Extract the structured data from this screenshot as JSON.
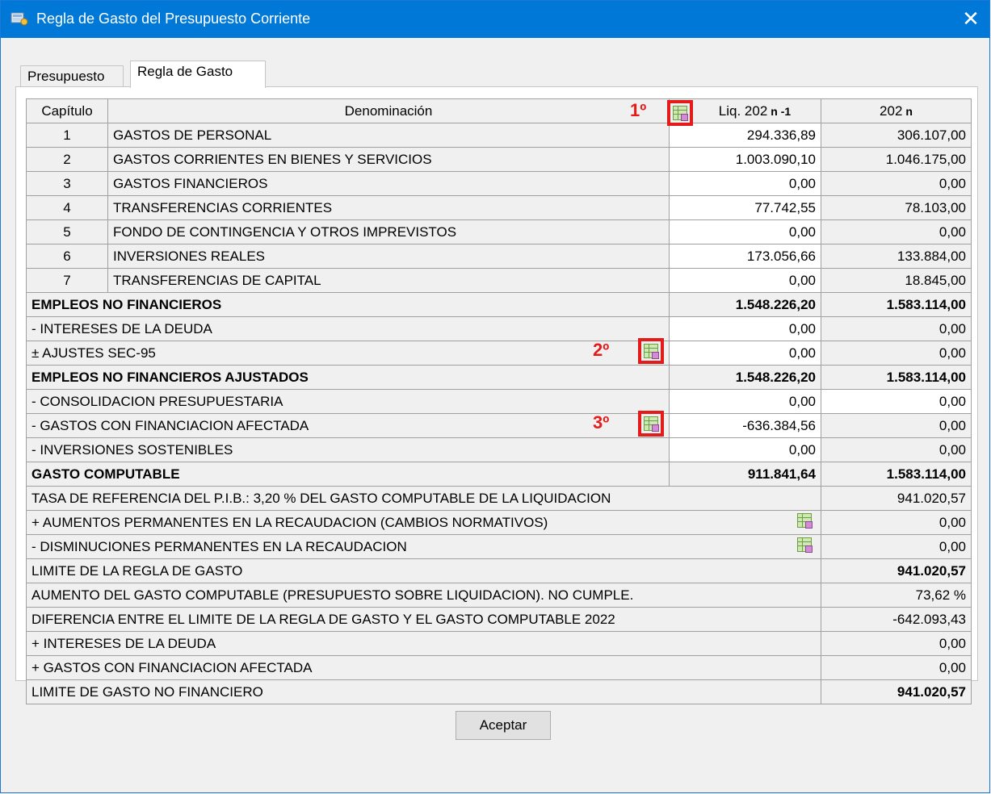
{
  "window": {
    "title": "Regla de Gasto del Presupuesto Corriente"
  },
  "tabs": [
    {
      "label": "Presupuesto"
    },
    {
      "label": "Regla de Gasto"
    }
  ],
  "table": {
    "headers": {
      "capitulo": "Capítulo",
      "denominacion": "Denominación",
      "liq_prefix": "Liq. 202",
      "liq_sup": "n -1",
      "year_prefix": "202",
      "year_sup": "n"
    },
    "chapters": [
      {
        "num": "1",
        "name": "GASTOS DE PERSONAL",
        "liq": "294.336,89",
        "pres": "306.107,00"
      },
      {
        "num": "2",
        "name": "GASTOS CORRIENTES EN BIENES Y SERVICIOS",
        "liq": "1.003.090,10",
        "pres": "1.046.175,00"
      },
      {
        "num": "3",
        "name": "GASTOS FINANCIEROS",
        "liq": "0,00",
        "pres": "0,00"
      },
      {
        "num": "4",
        "name": "TRANSFERENCIAS CORRIENTES",
        "liq": "77.742,55",
        "pres": "78.103,00"
      },
      {
        "num": "5",
        "name": "FONDO DE CONTINGENCIA Y OTROS IMPREVISTOS",
        "liq": "0,00",
        "pres": "0,00"
      },
      {
        "num": "6",
        "name": "INVERSIONES REALES",
        "liq": "173.056,66",
        "pres": "133.884,00"
      },
      {
        "num": "7",
        "name": "TRANSFERENCIAS DE CAPITAL",
        "liq": "0,00",
        "pres": "18.845,00"
      }
    ],
    "summary": [
      {
        "label": "EMPLEOS NO FINANCIEROS",
        "liq": "1.548.226,20",
        "pres": "1.583.114,00",
        "bold": true
      },
      {
        "label": "- INTERESES DE LA DEUDA",
        "liq": "0,00",
        "pres": "0,00"
      },
      {
        "label": "± AJUSTES SEC-95",
        "liq": "0,00",
        "pres": "0,00"
      },
      {
        "label": "EMPLEOS NO FINANCIEROS AJUSTADOS",
        "liq": "1.548.226,20",
        "pres": "1.583.114,00",
        "bold": true
      },
      {
        "label": "- CONSOLIDACION PRESUPUESTARIA",
        "liq": "0,00",
        "pres": "0,00"
      },
      {
        "label": "- GASTOS CON FINANCIACION AFECTADA",
        "liq": "-636.384,56",
        "pres": "0,00"
      },
      {
        "label": "- INVERSIONES SOSTENIBLES",
        "liq": "0,00",
        "pres": "0,00"
      },
      {
        "label": "GASTO COMPUTABLE",
        "liq": "911.841,64",
        "pres": "1.583.114,00",
        "bold": true
      }
    ],
    "limits": [
      {
        "label": "TASA DE REFERENCIA DEL P.I.B.: 3,20 % DEL GASTO COMPUTABLE DE LA LIQUIDACION",
        "value": "941.020,57"
      },
      {
        "label": "+ AUMENTOS PERMANENTES EN LA RECAUDACION (CAMBIOS NORMATIVOS)",
        "value": "0,00"
      },
      {
        "label": "- DISMINUCIONES PERMANENTES EN LA RECAUDACION",
        "value": "0,00"
      },
      {
        "label": "LIMITE DE LA REGLA DE GASTO",
        "value": "941.020,57",
        "bold": true
      },
      {
        "label": "AUMENTO DEL GASTO COMPUTABLE (PRESUPUESTO SOBRE LIQUIDACION). NO CUMPLE.",
        "value": "73,62 %"
      },
      {
        "label": "DIFERENCIA ENTRE EL LIMITE DE LA REGLA DE GASTO Y EL GASTO COMPUTABLE 2022",
        "value": "-642.093,43"
      },
      {
        "label": "+ INTERESES DE LA DEUDA",
        "value": "0,00"
      },
      {
        "label": "+ GASTOS CON FINANCIACION AFECTADA",
        "value": "0,00"
      },
      {
        "label": "LIMITE DE GASTO NO FINANCIERO",
        "value": "941.020,57",
        "bold": true
      }
    ]
  },
  "markers": {
    "m1": "1º",
    "m2": "2º",
    "m3": "3º"
  },
  "icons": {
    "calc": "spreadsheet-edit-icon",
    "app": "app-icon",
    "close": "close-icon"
  },
  "colors": {
    "titlebar": "#0078d7",
    "marker": "#e31b1b"
  },
  "buttons": {
    "accept": "Aceptar"
  },
  "close_glyph": "✕"
}
